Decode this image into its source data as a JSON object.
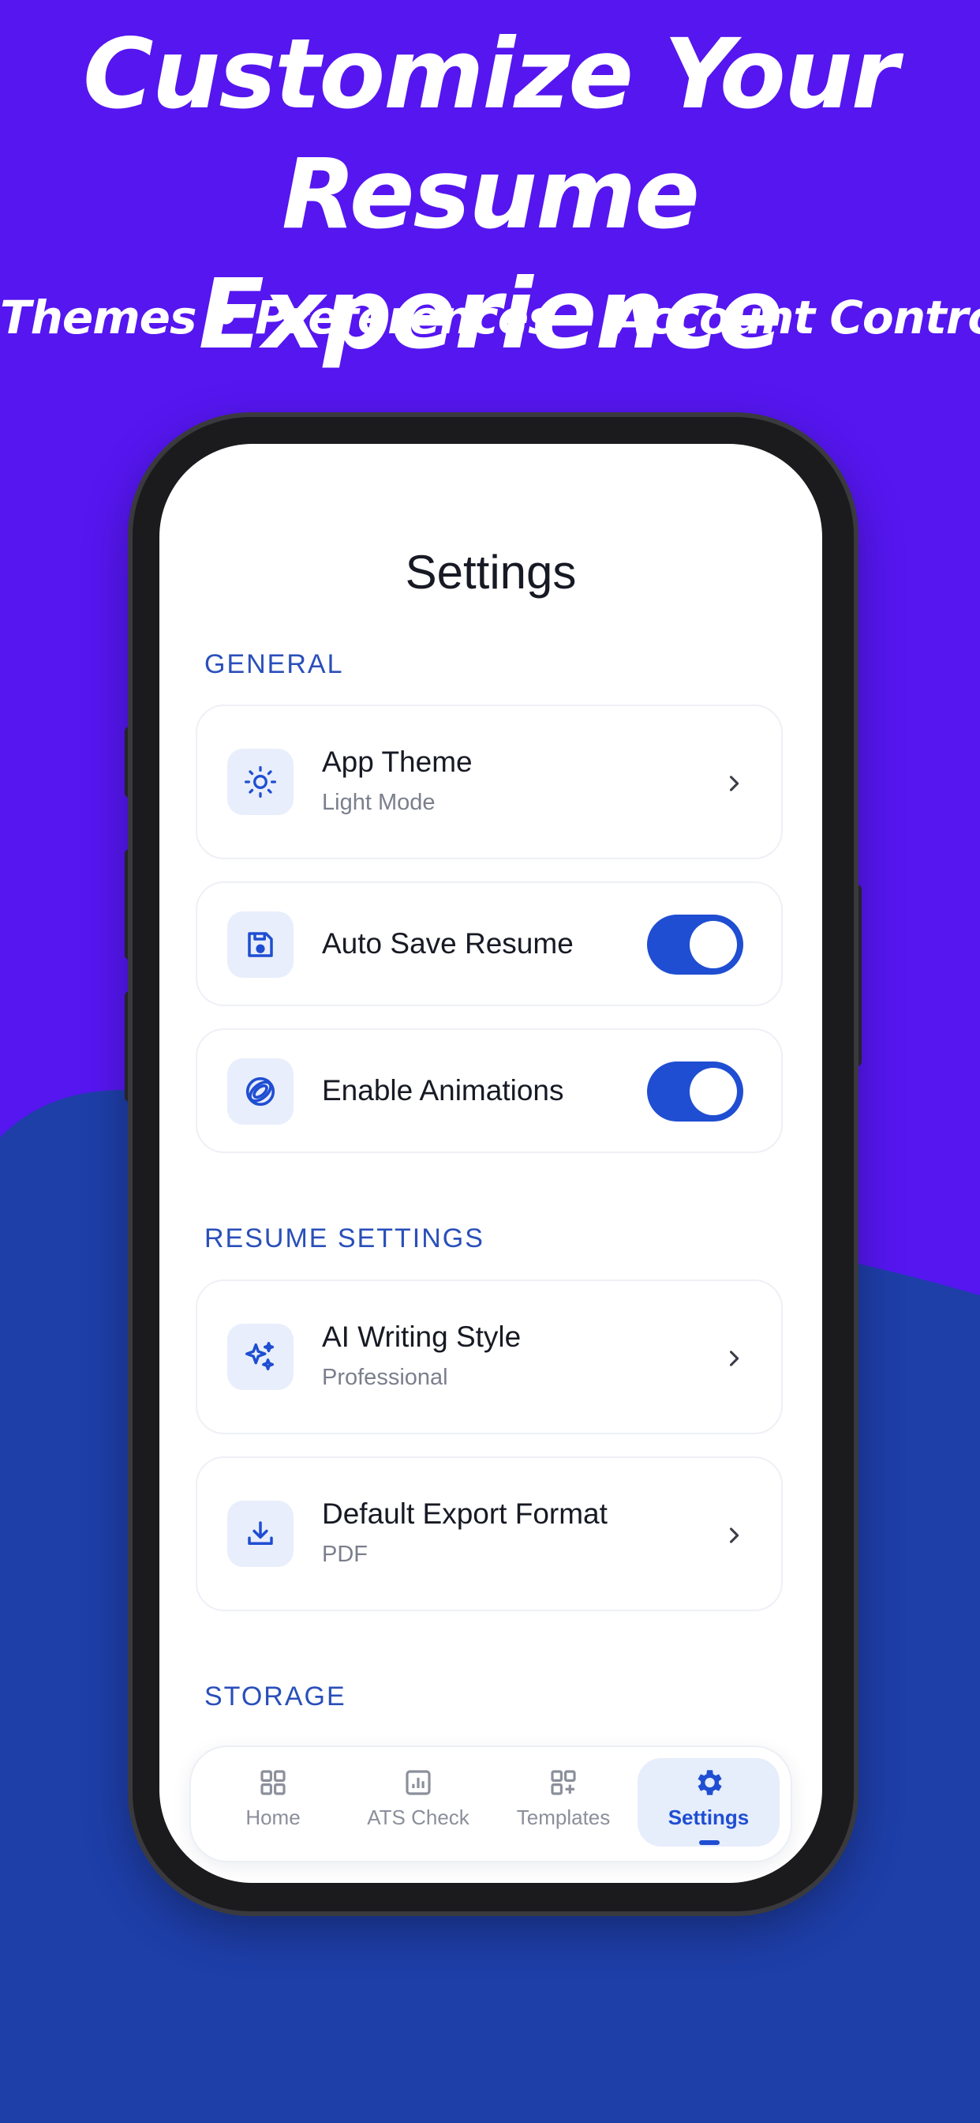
{
  "promo": {
    "headline_line1": "Customize Your",
    "headline_line2": "Resume Experience",
    "subline": "Themes • Preferences • Account Control"
  },
  "colors": {
    "background_top": "#5516f0",
    "background_bottom": "#1e3ea8",
    "accent": "#1f4ed2",
    "section_text": "#2a4fba",
    "icon_bg": "#e8eefb"
  },
  "screen": {
    "title": "Settings",
    "sections": {
      "general": "GENERAL",
      "resume": "RESUME SETTINGS",
      "storage": "STORAGE"
    },
    "items": {
      "app_theme": {
        "label": "App Theme",
        "value": "Light Mode",
        "icon": "sun-icon"
      },
      "auto_save": {
        "label": "Auto Save Resume",
        "enabled": true,
        "icon": "floppy-disk-icon"
      },
      "animations": {
        "label": "Enable Animations",
        "enabled": true,
        "icon": "rings-icon"
      },
      "ai_style": {
        "label": "AI Writing Style",
        "value": "Professional",
        "icon": "sparkles-icon"
      },
      "export_format": {
        "label": "Default Export Format",
        "value": "PDF",
        "icon": "download-icon"
      }
    },
    "tabs": [
      {
        "label": "Home",
        "icon": "grid-icon",
        "active": false
      },
      {
        "label": "ATS Check",
        "icon": "chart-doc-icon",
        "active": false
      },
      {
        "label": "Templates",
        "icon": "grid-plus-icon",
        "active": false
      },
      {
        "label": "Settings",
        "icon": "gear-icon",
        "active": true
      }
    ]
  }
}
